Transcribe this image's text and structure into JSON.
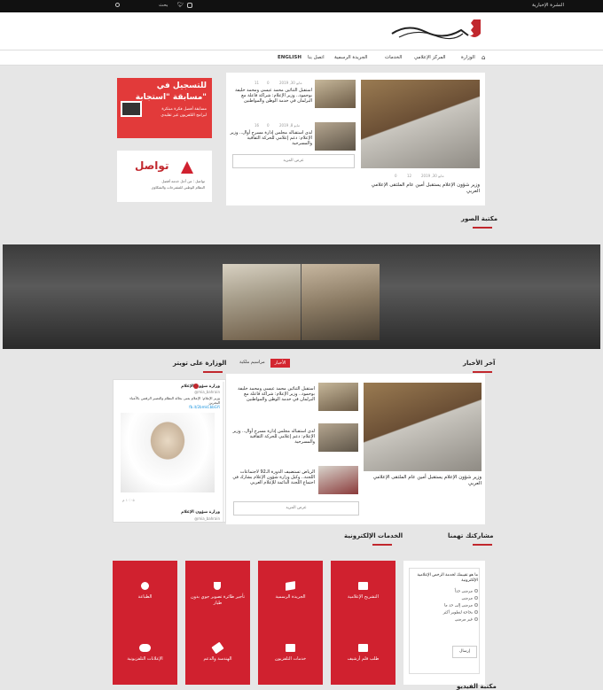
{
  "topbar": {
    "bulletin": "النشرة الإخبارية",
    "search_label": "بحث"
  },
  "nav": {
    "items": [
      "الوزارة",
      "المركز الإعلامي",
      "الخدمات",
      "الجريدة الرسمية",
      "اتصل بنا",
      "ENGLISH"
    ]
  },
  "hero": {
    "main_title": "وزير شؤون الإعلام يستقبل أمين عام الملتقى الإعلامي العربي",
    "main_meta": {
      "date": "2019 ,30 مايو",
      "views": "12",
      "comments": "0"
    },
    "items": [
      {
        "title": "استقبل الثنائين محمد عيسى ومحمد خليفة بوحمود.. وزير الإعلام: شراكة فاعلة مع البرلمان في خدمة الوطن والمواطنين",
        "date": "2019 ,30 مايو",
        "views": "11",
        "comments": "0"
      },
      {
        "title": "لدى استقباله مجلس إدارة مسرح أوال.. وزير الإعلام: دعم إعلامي للحركة الثقافية والمسرحية",
        "date": "2019 ,8 مايو",
        "views": "16",
        "comments": "0"
      }
    ],
    "more_label": "عرض المزيد"
  },
  "ads": {
    "istijaba": {
      "line1": "للتسجيل في",
      "line2": "مسابقة \"استجابة\"",
      "line3": "مسابقة أفضل فكرة مبتكرة",
      "line4": "لبرامج التلفزيون غير تقليدي"
    },
    "tawasul": {
      "name": "تواصل",
      "sub": "تواصل : من أجل خدمة أفضل",
      "sub2": "النظام الوطني للمقترحات والشكاوى"
    }
  },
  "photo_lib": {
    "title": "مكتبة الصور"
  },
  "latest_news": {
    "title": "آخر الأخبار",
    "main_title": "وزير شؤون الإعلام يستقبل أمين عام الملتقى الإعلامي العربي",
    "items": [
      {
        "title": "استقبل الثنائين محمد عيسى ومحمد خليفة بوحمود.. وزير الإعلام: شراكة فاعلة مع البرلمان في خدمة الوطن والمواطنين"
      },
      {
        "title": "لدى استقباله مجلس إدارة مسرح أوال.. وزير الإعلام: دعم إعلامي للحركة الثقافية والمسرحية"
      },
      {
        "title": "الرياض تستضيف الدورة الـ92 لاجتماعات اللجنة.. وكيل وزارة شؤون الإعلام يشارك في اجتماع اللجنة الدائمة للإعلام العربي"
      }
    ],
    "more_label": "عرض المزيد"
  },
  "tabs": {
    "active": "الأخبار",
    "other": "مراسيم ملكية"
  },
  "twitter": {
    "title": "الوزارة على تويتر",
    "account": "وزارة شؤون الإعلام",
    "handle": "@mia_bahrain",
    "tweet": "وزير الإعلام: الإعلام يعنى بحالة النظام والتعبير الرقمي بالأعباء البحرين",
    "link": "fb.it/2bmkCbbGYi",
    "footer_date": "١٠:٠٥ م"
  },
  "eservices": {
    "title": "الخدمات الإلكترونية",
    "items": [
      {
        "label": "التشريح الإعلامية",
        "icon": "briefcase-icon"
      },
      {
        "label": "الجريدة الرسمية",
        "icon": "book-icon"
      },
      {
        "label": "تأجير طائرة تصوير جوي بدون طيار",
        "icon": "shield-icon"
      },
      {
        "label": "الطباعة",
        "icon": "info-icon"
      },
      {
        "label": "طلب فلم أرشيف",
        "icon": "calendar-icon"
      },
      {
        "label": "خدمات التلفزيون",
        "icon": "tv-icon"
      },
      {
        "label": "الهندسة والدعم",
        "icon": "gavel-icon"
      },
      {
        "label": "الإعلانات التلفزيونية",
        "icon": "toggle-icon"
      }
    ]
  },
  "poll": {
    "title": "مشاركتك تهمنا",
    "question": "ما هو تقييمك لخدمة الرخص الإعلامية الإلكترونية",
    "options": [
      "مرضي جداً",
      "مرضي",
      "مرضي إلى حد ما",
      "بحاجة لتطوير أكثر",
      "غير مرضي"
    ],
    "submit": "إرسال"
  },
  "video_lib": {
    "title": "مكتبة الفيديو"
  },
  "colors": {
    "accent": "#c1272d",
    "service_bg": "#d0212f",
    "topbar": "#111111"
  }
}
